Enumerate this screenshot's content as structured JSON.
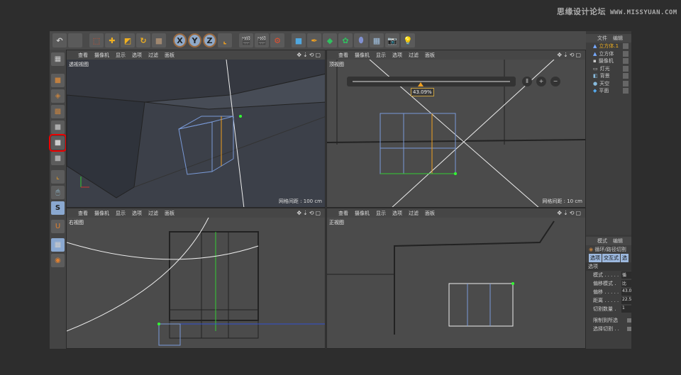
{
  "watermark": {
    "cn": "思缘设计论坛",
    "url": "WWW.MISSYUAN.COM"
  },
  "toolbar": {
    "tools": [
      "undo",
      "redo",
      "live-selection",
      "move",
      "scale",
      "rotate",
      "object-mode",
      "x-axis",
      "y-axis",
      "z-axis",
      "coordinate-system",
      "render-view",
      "render-picture-viewer",
      "render-settings",
      "cube",
      "pen",
      "subdivision",
      "array",
      "deformer",
      "floor",
      "camera",
      "light"
    ],
    "axis_labels": [
      "X",
      "Y",
      "Z"
    ]
  },
  "left_tools": [
    "model-mode",
    "object-mode",
    "texture-mode",
    "points-mode",
    "edges-mode",
    "polygons-mode",
    "axis-mode",
    "tweak",
    "snap",
    "magnet",
    "grid",
    "soft-select"
  ],
  "viewport_menu": [
    "查看",
    "摄像机",
    "显示",
    "选项",
    "过滤",
    "面板"
  ],
  "viewports": [
    {
      "name": "透视视图",
      "grid": "网格间距 : 100 cm"
    },
    {
      "name": "顶视图",
      "grid": "网格间距 : 10 cm",
      "slider_value": "43.09%",
      "slider_fraction": 0.43
    },
    {
      "name": "右视图",
      "grid": ""
    },
    {
      "name": "正视图",
      "grid": ""
    }
  ],
  "object_manager": {
    "menu": [
      "文件",
      "编辑"
    ],
    "objects": [
      "立方体.1",
      "立方体",
      "摄像机",
      "灯光",
      "背景",
      "天空",
      "平面"
    ],
    "active": "立方体.1"
  },
  "attributes": {
    "menu": [
      "模式",
      "编辑"
    ],
    "tool": "循环/路径切割",
    "tabs": [
      "选项",
      "交互式",
      "选"
    ],
    "section": "选项",
    "fields": [
      {
        "label": "模式 . . . . .",
        "value": "循"
      },
      {
        "label": "偏移模式 .",
        "value": "比"
      },
      {
        "label": "偏移 . . . . .",
        "value": "43.0"
      },
      {
        "label": "距离 . . . . .",
        "value": "22.5"
      },
      {
        "label": "切割数量 .",
        "value": "1"
      }
    ],
    "checks": [
      "限制到所选",
      "选择切割 . ."
    ]
  },
  "colors": {
    "accent": "#f0a020",
    "selection": "#e00000",
    "axis_x": "#c03030",
    "axis_y": "#30c030",
    "axis_z": "#3050d0"
  }
}
